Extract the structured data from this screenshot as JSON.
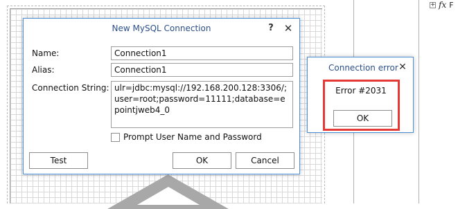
{
  "main_dialog": {
    "title": "New MySQL Connection",
    "help_glyph": "?",
    "close_glyph": "✕",
    "fields": {
      "name_label": "Name:",
      "name_value": "Connection1",
      "alias_label": "Alias:",
      "alias_value": "Connection1",
      "connection_string_label": "Connection String:",
      "connection_string_value": "ulr=jdbc:mysql://192.168.200.128:3306/;user=root;password=11111;database=epointjweb4_0"
    },
    "prompt_checkbox_label": "Prompt User Name and Password",
    "buttons": {
      "test": "Test",
      "ok": "OK",
      "cancel": "Cancel"
    }
  },
  "error_dialog": {
    "title": "Connection error",
    "close_glyph": "✕",
    "message": "Error #2031",
    "ok": "OK",
    "highlight_color": "#e53935"
  },
  "side_panel": {
    "expand_glyph": "+",
    "fx_glyph": "fx",
    "truncated_label": "F"
  },
  "colors": {
    "accent_border": "#4a90d9",
    "title_text": "#2b4f8a"
  }
}
